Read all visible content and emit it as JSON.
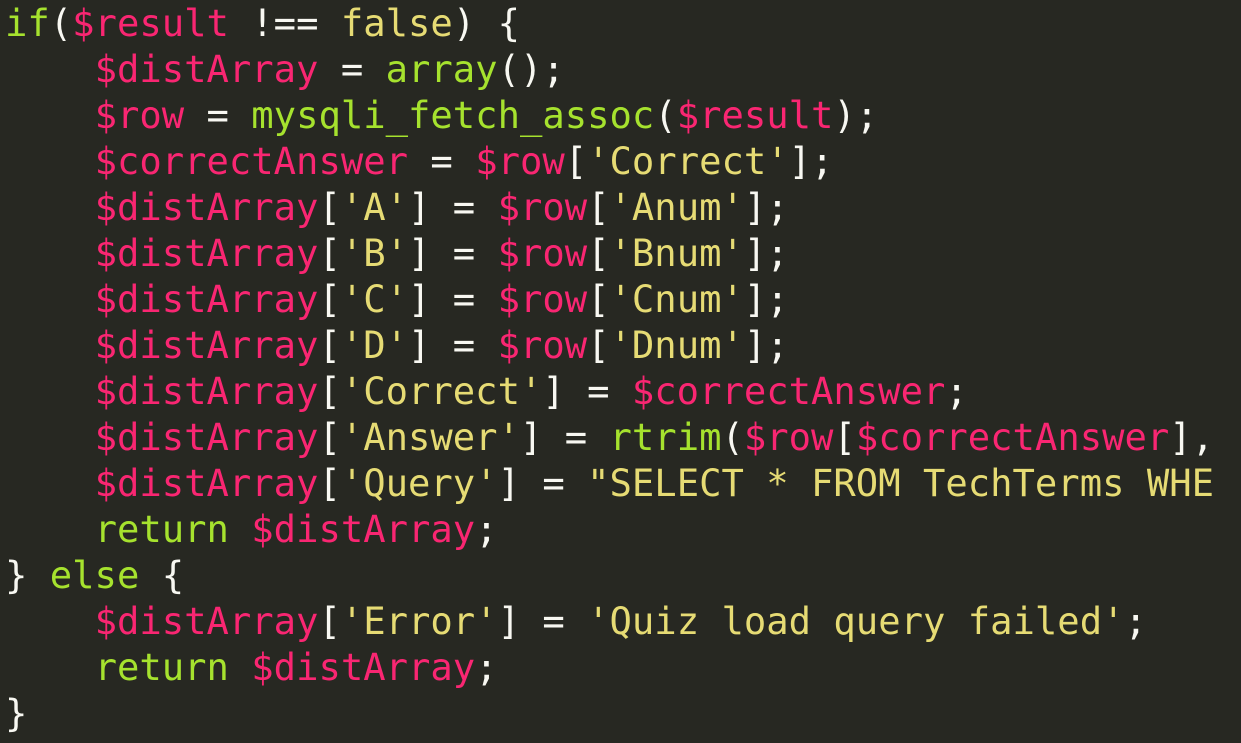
{
  "colors": {
    "background": "#272822",
    "plain": "#f8f8f2",
    "keyword": "#a6e22e",
    "variable": "#f92672",
    "operator": "#f8f8f2",
    "function": "#a6e22e",
    "string": "#e6db74"
  },
  "code": {
    "lines": [
      [
        {
          "t": "kw",
          "v": "if"
        },
        {
          "t": "plain",
          "v": "("
        },
        {
          "t": "var",
          "v": "$result"
        },
        {
          "t": "plain",
          "v": " "
        },
        {
          "t": "op",
          "v": "!=="
        },
        {
          "t": "plain",
          "v": " "
        },
        {
          "t": "str",
          "v": "false"
        },
        {
          "t": "plain",
          "v": ") {"
        }
      ],
      [
        {
          "t": "plain",
          "v": "    "
        },
        {
          "t": "var",
          "v": "$distArray"
        },
        {
          "t": "plain",
          "v": " "
        },
        {
          "t": "op",
          "v": "="
        },
        {
          "t": "plain",
          "v": " "
        },
        {
          "t": "fn",
          "v": "array"
        },
        {
          "t": "plain",
          "v": "();"
        }
      ],
      [
        {
          "t": "plain",
          "v": "    "
        },
        {
          "t": "var",
          "v": "$row"
        },
        {
          "t": "plain",
          "v": " "
        },
        {
          "t": "op",
          "v": "="
        },
        {
          "t": "plain",
          "v": " "
        },
        {
          "t": "fn",
          "v": "mysqli_fetch_assoc"
        },
        {
          "t": "plain",
          "v": "("
        },
        {
          "t": "var",
          "v": "$result"
        },
        {
          "t": "plain",
          "v": ");"
        }
      ],
      [
        {
          "t": "plain",
          "v": "    "
        },
        {
          "t": "var",
          "v": "$correctAnswer"
        },
        {
          "t": "plain",
          "v": " "
        },
        {
          "t": "op",
          "v": "="
        },
        {
          "t": "plain",
          "v": " "
        },
        {
          "t": "var",
          "v": "$row"
        },
        {
          "t": "plain",
          "v": "["
        },
        {
          "t": "str",
          "v": "'Correct'"
        },
        {
          "t": "plain",
          "v": "];"
        }
      ],
      [
        {
          "t": "plain",
          "v": "    "
        },
        {
          "t": "var",
          "v": "$distArray"
        },
        {
          "t": "plain",
          "v": "["
        },
        {
          "t": "str",
          "v": "'A'"
        },
        {
          "t": "plain",
          "v": "] "
        },
        {
          "t": "op",
          "v": "="
        },
        {
          "t": "plain",
          "v": " "
        },
        {
          "t": "var",
          "v": "$row"
        },
        {
          "t": "plain",
          "v": "["
        },
        {
          "t": "str",
          "v": "'Anum'"
        },
        {
          "t": "plain",
          "v": "];"
        }
      ],
      [
        {
          "t": "plain",
          "v": "    "
        },
        {
          "t": "var",
          "v": "$distArray"
        },
        {
          "t": "plain",
          "v": "["
        },
        {
          "t": "str",
          "v": "'B'"
        },
        {
          "t": "plain",
          "v": "] "
        },
        {
          "t": "op",
          "v": "="
        },
        {
          "t": "plain",
          "v": " "
        },
        {
          "t": "var",
          "v": "$row"
        },
        {
          "t": "plain",
          "v": "["
        },
        {
          "t": "str",
          "v": "'Bnum'"
        },
        {
          "t": "plain",
          "v": "];"
        }
      ],
      [
        {
          "t": "plain",
          "v": "    "
        },
        {
          "t": "var",
          "v": "$distArray"
        },
        {
          "t": "plain",
          "v": "["
        },
        {
          "t": "str",
          "v": "'C'"
        },
        {
          "t": "plain",
          "v": "] "
        },
        {
          "t": "op",
          "v": "="
        },
        {
          "t": "plain",
          "v": " "
        },
        {
          "t": "var",
          "v": "$row"
        },
        {
          "t": "plain",
          "v": "["
        },
        {
          "t": "str",
          "v": "'Cnum'"
        },
        {
          "t": "plain",
          "v": "];"
        }
      ],
      [
        {
          "t": "plain",
          "v": "    "
        },
        {
          "t": "var",
          "v": "$distArray"
        },
        {
          "t": "plain",
          "v": "["
        },
        {
          "t": "str",
          "v": "'D'"
        },
        {
          "t": "plain",
          "v": "] "
        },
        {
          "t": "op",
          "v": "="
        },
        {
          "t": "plain",
          "v": " "
        },
        {
          "t": "var",
          "v": "$row"
        },
        {
          "t": "plain",
          "v": "["
        },
        {
          "t": "str",
          "v": "'Dnum'"
        },
        {
          "t": "plain",
          "v": "];"
        }
      ],
      [
        {
          "t": "plain",
          "v": "    "
        },
        {
          "t": "var",
          "v": "$distArray"
        },
        {
          "t": "plain",
          "v": "["
        },
        {
          "t": "str",
          "v": "'Correct'"
        },
        {
          "t": "plain",
          "v": "] "
        },
        {
          "t": "op",
          "v": "="
        },
        {
          "t": "plain",
          "v": " "
        },
        {
          "t": "var",
          "v": "$correctAnswer"
        },
        {
          "t": "plain",
          "v": ";"
        }
      ],
      [
        {
          "t": "plain",
          "v": "    "
        },
        {
          "t": "var",
          "v": "$distArray"
        },
        {
          "t": "plain",
          "v": "["
        },
        {
          "t": "str",
          "v": "'Answer'"
        },
        {
          "t": "plain",
          "v": "] "
        },
        {
          "t": "op",
          "v": "="
        },
        {
          "t": "plain",
          "v": " "
        },
        {
          "t": "fn",
          "v": "rtrim"
        },
        {
          "t": "plain",
          "v": "("
        },
        {
          "t": "var",
          "v": "$row"
        },
        {
          "t": "plain",
          "v": "["
        },
        {
          "t": "var",
          "v": "$correctAnswer"
        },
        {
          "t": "plain",
          "v": "],"
        }
      ],
      [
        {
          "t": "plain",
          "v": "    "
        },
        {
          "t": "var",
          "v": "$distArray"
        },
        {
          "t": "plain",
          "v": "["
        },
        {
          "t": "str",
          "v": "'Query'"
        },
        {
          "t": "plain",
          "v": "] "
        },
        {
          "t": "op",
          "v": "="
        },
        {
          "t": "plain",
          "v": " "
        },
        {
          "t": "str",
          "v": "\"SELECT * FROM TechTerms WHE"
        }
      ],
      [
        {
          "t": "plain",
          "v": "    "
        },
        {
          "t": "kw",
          "v": "return"
        },
        {
          "t": "plain",
          "v": " "
        },
        {
          "t": "var",
          "v": "$distArray"
        },
        {
          "t": "plain",
          "v": ";"
        }
      ],
      [
        {
          "t": "plain",
          "v": "} "
        },
        {
          "t": "kw",
          "v": "else"
        },
        {
          "t": "plain",
          "v": " {"
        }
      ],
      [
        {
          "t": "plain",
          "v": "    "
        },
        {
          "t": "var",
          "v": "$distArray"
        },
        {
          "t": "plain",
          "v": "["
        },
        {
          "t": "str",
          "v": "'Error'"
        },
        {
          "t": "plain",
          "v": "] "
        },
        {
          "t": "op",
          "v": "="
        },
        {
          "t": "plain",
          "v": " "
        },
        {
          "t": "str",
          "v": "'Quiz load query failed'"
        },
        {
          "t": "plain",
          "v": ";"
        }
      ],
      [
        {
          "t": "plain",
          "v": "    "
        },
        {
          "t": "kw",
          "v": "return"
        },
        {
          "t": "plain",
          "v": " "
        },
        {
          "t": "var",
          "v": "$distArray"
        },
        {
          "t": "plain",
          "v": ";"
        }
      ],
      [
        {
          "t": "plain",
          "v": "}"
        }
      ]
    ]
  }
}
